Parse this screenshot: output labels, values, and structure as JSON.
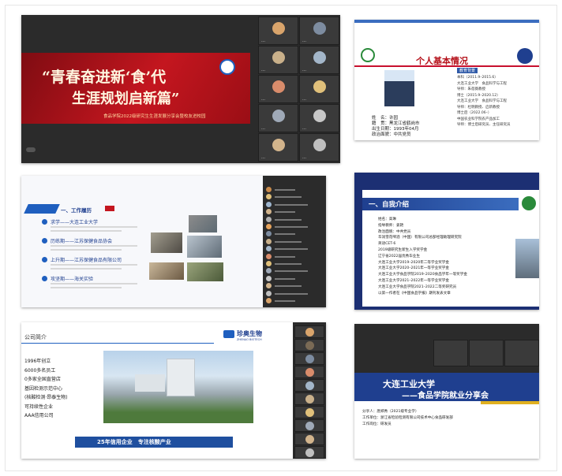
{
  "colors": {
    "accent_blue": "#1f5fbf",
    "banner_red": "#b5121b",
    "meeting_bg": "#2b2b2b"
  },
  "s1": {
    "title": "“青春奋进新‘食’代",
    "subtitle": "生涯规划启新篇”",
    "footer": "食品学院2022级研究生生涯发展分享会暨校友进校园",
    "participants": [
      {
        "name": "…",
        "color": "#d9a46b"
      },
      {
        "name": "…",
        "color": "#7d8ca0"
      },
      {
        "name": "…",
        "color": "#c9b08a"
      },
      {
        "name": "…",
        "color": "#a3b6c9"
      },
      {
        "name": "…",
        "color": "#d98c6b"
      },
      {
        "name": "…",
        "color": "#e0c07a"
      },
      {
        "name": "…",
        "color": "#9fa9b7"
      },
      {
        "name": "…",
        "color": "#c7c7c7"
      },
      {
        "name": "…",
        "color": "#d2b48c"
      },
      {
        "name": "…",
        "color": "#bfbfbf"
      }
    ]
  },
  "s2": {
    "title": "个人基本情况",
    "edu_header": "教育背景",
    "fields": [
      "姓　名：许园",
      "籍　贯：黑龙江省鹤岗市",
      "出生日期：1993年04月",
      "政治面貌：中共党员"
    ],
    "edu_lines": [
      "本科（2011.9–2015.6）",
      "大连工业大学　食品科学与工程",
      "导师：朱蓓薇教授",
      "博士（2015.9–2020.12）",
      "大连工业大学　食品科学与工程",
      "导师：杜明教授、启新教授",
      "博士后（2022.06–）",
      "中国农业科学院农产品加工",
      "导师：博士后研究员、主任研究员"
    ]
  },
  "s3": {
    "section": "一、工作履历",
    "items": [
      "求学——大连工业大学",
      "历练期——江苏保健食品协会",
      "上升期——江苏保健食品有限公司",
      "攻坚期——海关实验"
    ]
  },
  "s4": {
    "title": "一、自我介绍",
    "lines": [
      "姓名：高琳",
      "指导教师：姜艳",
      "政治面貌：中共党员",
      "华润雪花啤酒（中国）有限公司总部经理助理研究院",
      "英语CET-6",
      "2019级研究生新生入学奖学金",
      "辽宁省2022届优秀毕业生",
      "大连工业大学2019–2020年二等学业奖学金",
      "大连工业大学2020–2021年一等学业奖学金",
      "大连工业大学食品学院2019–2020食品学年一等奖学金",
      "大连工业大学2021–2022年一等学业奖学金",
      "大连工业大学食品学院2021–2022二等奖研究员",
      "以第一作者在《中国食品学报》期刊发表文章"
    ]
  },
  "s5": {
    "heading": "公司简介",
    "brand": "珍奥生物",
    "brand_en": "ZHENAO BIOTECH",
    "facts": [
      "1996年创立",
      "6000多名员工",
      "0多家全国直营店",
      "基因检测示范中心",
      "(核酸检测·昂泰生物)",
      "可持续性企业",
      "AAA信用公司"
    ],
    "slogan": "25年信用企业　专注核酸产业"
  },
  "s6": {
    "title": "大连工业大学",
    "subtitle": "——食品学院就业分享会",
    "info": [
      "分享人：唐郑秀（2021级专业学）",
      "工作单位：浙江省检验检测有限公司技术中心食品研发部",
      "工作岗位：研发员"
    ]
  }
}
